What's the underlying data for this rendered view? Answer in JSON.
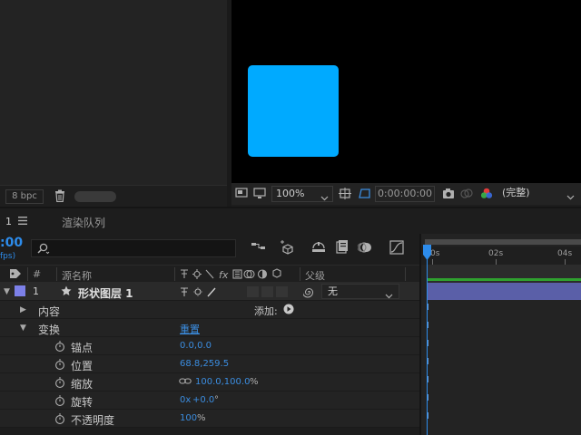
{
  "project_panel": {
    "bpc_label": "8 bpc"
  },
  "viewer": {
    "zoom": "100%",
    "timecode": "0:00:00:00",
    "quality": "(完整)",
    "shape_color": "#00aaff"
  },
  "timeline": {
    "comp_tab": "1",
    "render_queue_tab": "渲染队列",
    "current_time": ":00",
    "fps_label": "fps)",
    "columns": {
      "number": "#",
      "source_name": "源名称",
      "parent": "父级"
    },
    "layer": {
      "number": "1",
      "name": "形状图层 1",
      "parent_value": "无",
      "label_color": "#7c80e8"
    },
    "contents": {
      "label": "内容",
      "add_label": "添加:"
    },
    "transform": {
      "label": "变换",
      "reset_label": "重置",
      "properties": [
        {
          "name": "锚点",
          "value": "0.0,0.0"
        },
        {
          "name": "位置",
          "value": "68.8,259.5"
        },
        {
          "name": "缩放",
          "value": "100.0,100.0",
          "unit": "%"
        },
        {
          "name": "旋转",
          "value": "0x",
          "value2": "+0.0",
          "unit": "°"
        },
        {
          "name": "不透明度",
          "value": "100",
          "unit": "%"
        }
      ]
    },
    "ruler": {
      "labels": [
        "0s",
        "02s",
        "04s"
      ]
    }
  }
}
